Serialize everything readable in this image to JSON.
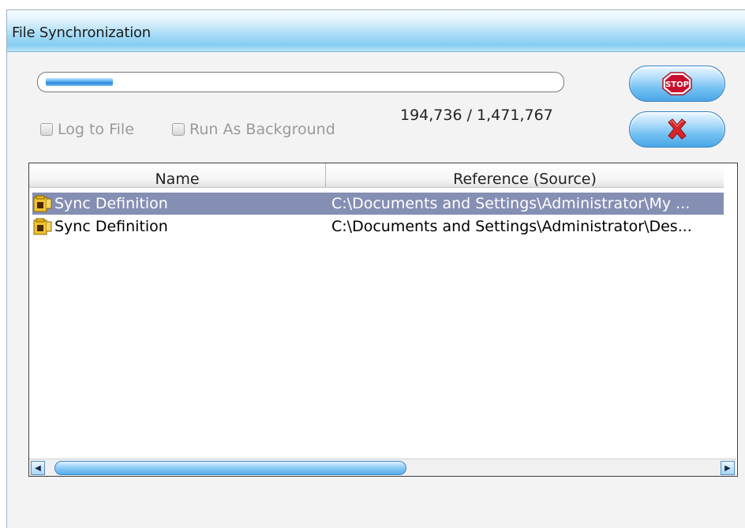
{
  "window": {
    "title": "File Synchronization"
  },
  "progress": {
    "fraction": 0.1323,
    "counter_text": "194,736 / 1,471,767"
  },
  "options": {
    "log_to_file": {
      "label": "Log to File",
      "checked": false,
      "enabled": false
    },
    "run_as_background": {
      "label": "Run As Background",
      "checked": false,
      "enabled": false
    }
  },
  "buttons": {
    "stop": {
      "icon": "stop-sign-icon",
      "label": "STOP"
    },
    "cancel": {
      "icon": "red-x-icon"
    }
  },
  "list": {
    "columns": [
      "Name",
      "Reference (Source)"
    ],
    "rows": [
      {
        "name": "Sync Definition",
        "reference": "C:\\Documents and Settings\\Administrator\\My ...",
        "selected": true,
        "icon": "sync-definition-icon"
      },
      {
        "name": "Sync Definition",
        "reference": "C:\\Documents and Settings\\Administrator\\Des...",
        "selected": false,
        "icon": "sync-definition-icon"
      }
    ]
  },
  "colors": {
    "selection": "#858fb3",
    "accent": "#4aa6e6",
    "stop_red": "#c8102e"
  }
}
